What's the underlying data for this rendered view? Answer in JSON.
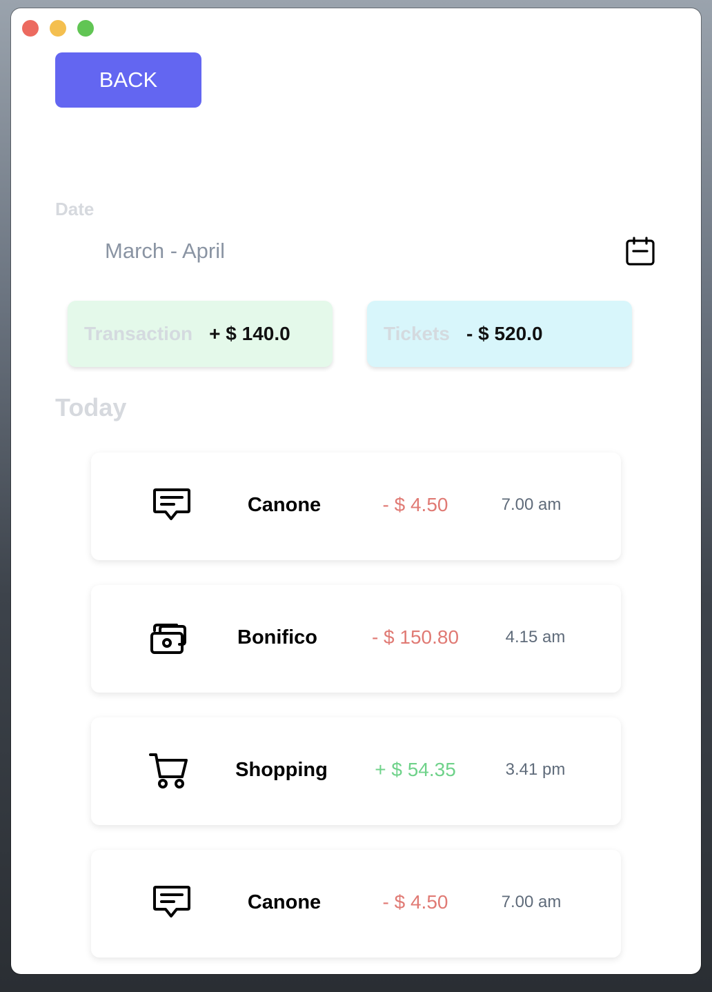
{
  "window": {
    "controls": [
      "close",
      "minimize",
      "zoom"
    ]
  },
  "back_button": {
    "label": "BACK"
  },
  "date": {
    "label": "Date",
    "value": "March - April",
    "icon": "calendar-icon"
  },
  "summary": {
    "transaction": {
      "label": "Transaction",
      "amount": "+ $ 140.0"
    },
    "tickets": {
      "label": "Tickets",
      "amount": "- $ 520.0"
    }
  },
  "section_title": "Today",
  "transactions": [
    {
      "icon": "message-icon",
      "name": "Canone",
      "amount": "- $ 4.50",
      "time": "7.00 am",
      "sign": "negative"
    },
    {
      "icon": "cash-icon",
      "name": "Bonifico",
      "amount": "- $ 150.80",
      "time": "4.15 am",
      "sign": "negative"
    },
    {
      "icon": "shopping-cart-icon",
      "name": "Shopping",
      "amount": "+ $ 54.35",
      "time": "3.41 pm",
      "sign": "positive"
    },
    {
      "icon": "message-icon",
      "name": "Canone",
      "amount": "- $ 4.50",
      "time": "7.00 am",
      "sign": "negative"
    }
  ],
  "colors": {
    "accent": "#6366f1",
    "negative": "#e07a74",
    "positive": "#6fd28a",
    "transaction_bg": "#e4f9ea",
    "tickets_bg": "#d8f6fb"
  }
}
